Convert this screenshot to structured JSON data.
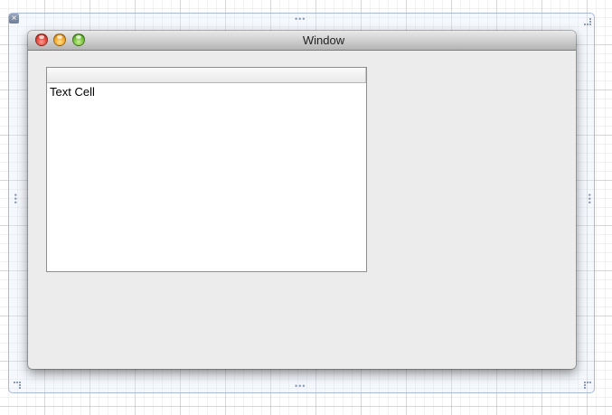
{
  "window": {
    "title": "Window"
  },
  "table": {
    "header_label": "",
    "rows": [
      {
        "cell": "Text Cell"
      }
    ]
  },
  "colors": {
    "window_background": "#ececec",
    "close_button": "#e0443a",
    "minimize_button": "#f2a52a",
    "zoom_button": "#71bd3a",
    "grid_line": "#6e96dc"
  },
  "icons": {
    "frame_close": "close-icon"
  }
}
